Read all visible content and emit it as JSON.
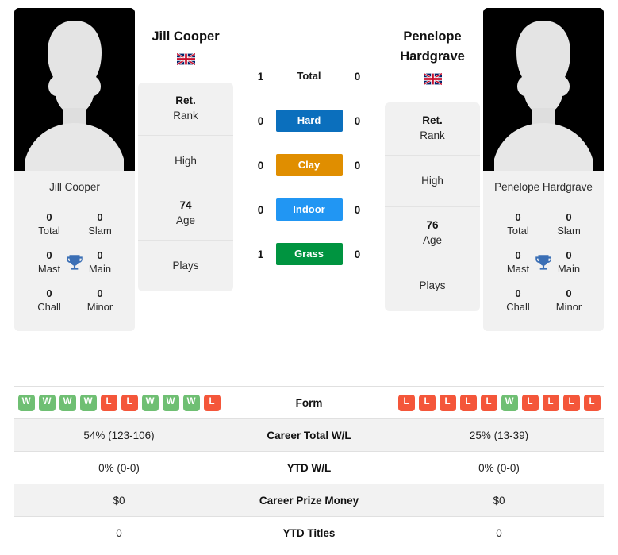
{
  "players": {
    "left": {
      "name": "Jill Cooper",
      "photo_caption": "Jill Cooper",
      "country": "united-kingdom",
      "titles": {
        "total_value": "0",
        "total_label": "Total",
        "slam_value": "0",
        "slam_label": "Slam",
        "mast_value": "0",
        "mast_label": "Mast",
        "main_value": "0",
        "main_label": "Main",
        "chall_value": "0",
        "chall_label": "Chall",
        "minor_value": "0",
        "minor_label": "Minor"
      },
      "info": {
        "rank_value": "Ret.",
        "rank_label": "Rank",
        "high_value": "",
        "high_label": "High",
        "age_value": "74",
        "age_label": "Age",
        "plays_value": "",
        "plays_label": "Plays"
      },
      "form": [
        "W",
        "W",
        "W",
        "W",
        "L",
        "L",
        "W",
        "W",
        "W",
        "L"
      ],
      "career_total_wl": "54% (123-106)",
      "ytd_wl": "0% (0-0)",
      "career_prize_money": "$0",
      "ytd_titles": "0"
    },
    "right": {
      "name": "Penelope Hardgrave",
      "photo_caption": "Penelope Hardgrave",
      "country": "united-kingdom",
      "titles": {
        "total_value": "0",
        "total_label": "Total",
        "slam_value": "0",
        "slam_label": "Slam",
        "mast_value": "0",
        "mast_label": "Mast",
        "main_value": "0",
        "main_label": "Main",
        "chall_value": "0",
        "chall_label": "Chall",
        "minor_value": "0",
        "minor_label": "Minor"
      },
      "info": {
        "rank_value": "Ret.",
        "rank_label": "Rank",
        "high_value": "",
        "high_label": "High",
        "age_value": "76",
        "age_label": "Age",
        "plays_value": "",
        "plays_label": "Plays"
      },
      "form": [
        "L",
        "L",
        "L",
        "L",
        "L",
        "W",
        "L",
        "L",
        "L",
        "L"
      ],
      "career_total_wl": "25% (13-39)",
      "ytd_wl": "0% (0-0)",
      "career_prize_money": "$0",
      "ytd_titles": "0"
    }
  },
  "h2h": {
    "rows": [
      {
        "label": "Total",
        "left": "1",
        "right": "0",
        "badge": false,
        "color": ""
      },
      {
        "label": "Hard",
        "left": "0",
        "right": "0",
        "badge": true,
        "color": "#0b6fbd"
      },
      {
        "label": "Clay",
        "left": "0",
        "right": "0",
        "badge": true,
        "color": "#e08e00"
      },
      {
        "label": "Indoor",
        "left": "0",
        "right": "0",
        "badge": true,
        "color": "#2196f3"
      },
      {
        "label": "Grass",
        "left": "1",
        "right": "0",
        "badge": true,
        "color": "#009440"
      }
    ]
  },
  "comparison": {
    "rows": [
      {
        "label": "Form",
        "type": "form"
      },
      {
        "label": "Career Total W/L",
        "type": "text",
        "left": "54% (123-106)",
        "right": "25% (13-39)"
      },
      {
        "label": "YTD W/L",
        "type": "text",
        "left": "0% (0-0)",
        "right": "0% (0-0)"
      },
      {
        "label": "Career Prize Money",
        "type": "text",
        "left": "$0",
        "right": "$0"
      },
      {
        "label": "YTD Titles",
        "type": "text",
        "left": "0",
        "right": "0"
      }
    ]
  },
  "colors": {
    "hard": "#0b6fbd",
    "clay": "#e08e00",
    "indoor": "#2196f3",
    "grass": "#009440",
    "win": "#6fbf73",
    "loss": "#f4563a",
    "trophy": "#3b6fb5",
    "card_bg": "#f1f1f1"
  }
}
